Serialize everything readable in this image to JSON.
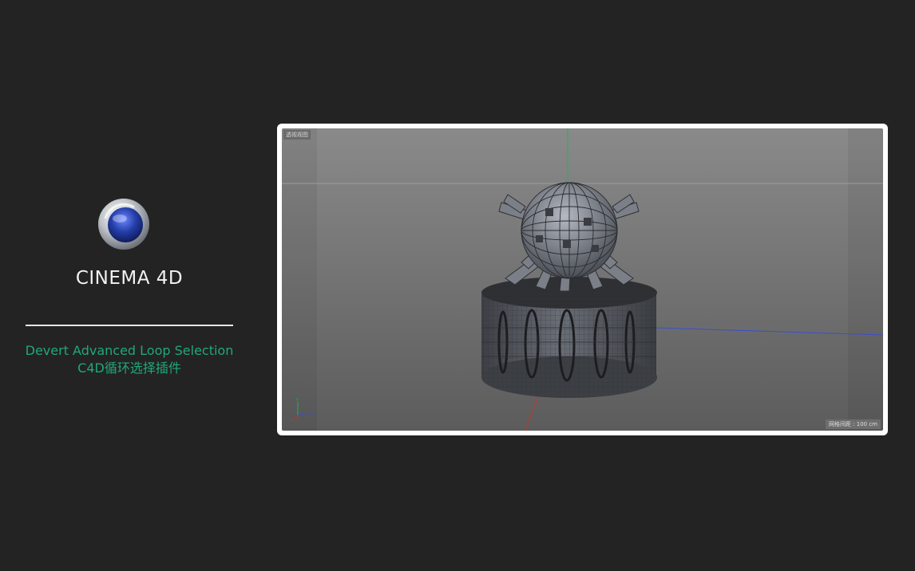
{
  "sidebar": {
    "brand_name": "CINEMA 4D",
    "plugin_title": "Devert Advanced Loop Selection",
    "plugin_subtitle": "C4D循环选择插件",
    "logo_icon": "cinema4d-logo-icon",
    "accent_color": "#1fa87a"
  },
  "viewport": {
    "view_label": "透视视图",
    "grid_spacing_label": "网格间距 : 100 cm",
    "axis_colors": {
      "x": "#c0392b",
      "y": "#27ae60",
      "z": "#3a4fd0"
    }
  }
}
